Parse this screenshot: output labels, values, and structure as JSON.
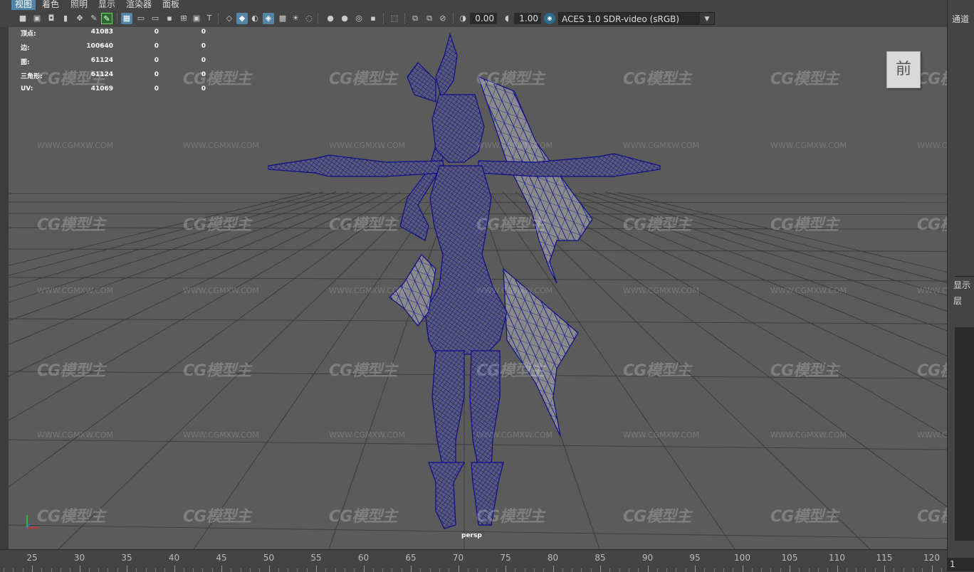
{
  "menu": {
    "items": [
      "视图",
      "着色",
      "照明",
      "显示",
      "渲染器",
      "面板"
    ],
    "active_index": 0
  },
  "toolbar": {
    "icons": [
      "camera-icon",
      "camera-attr-icon",
      "bookmark-icon",
      "image-plane-icon",
      "2d-pan-icon",
      "grease-pencil-icon",
      "grid-icon",
      "film-gate-icon",
      "resolution-gate-icon",
      "gate-mask-icon",
      "field-chart-icon",
      "safe-action-icon",
      "safe-title-icon",
      "wireframe-icon",
      "smooth-shade-icon",
      "default-material-icon",
      "wireframe-on-shaded-icon",
      "xray-icon",
      "textured-icon",
      "use-all-lights-icon",
      "shadows-icon",
      "screen-space-ao-icon",
      "motion-blur-icon",
      "multisample-aa-icon",
      "depth-of-field-icon",
      "isolate-select-icon",
      "xray-joints-icon",
      "xray-active-icon",
      "backface-culling-icon",
      "exposure-icon",
      "gamma-icon",
      "color-management-icon"
    ],
    "exposure_value": "0.00",
    "gamma_value": "1.00",
    "color_space": "ACES 1.0 SDR-video (sRGB)"
  },
  "hud": {
    "rows": [
      {
        "label": "顶点:",
        "v1": "41083",
        "v2": "0",
        "v3": "0"
      },
      {
        "label": "边:",
        "v1": "100640",
        "v2": "0",
        "v3": "0"
      },
      {
        "label": "面:",
        "v1": "61124",
        "v2": "0",
        "v3": "0"
      },
      {
        "label": "三角形:",
        "v1": "61124",
        "v2": "0",
        "v3": "0"
      },
      {
        "label": "UV:",
        "v1": "41069",
        "v2": "0",
        "v3": "0"
      }
    ]
  },
  "viewport": {
    "camera": "persp",
    "viewcube_label": "前",
    "watermark_logo": "CG模型主",
    "watermark_url": "WWW.CGMXW.COM",
    "wire_color": "#0d0d8a",
    "bg_color": "#5b5b5b"
  },
  "right_panel": {
    "top_label": "通道",
    "display_label": "显示",
    "layer_label": "层"
  },
  "timeline": {
    "labels": [
      "25",
      "30",
      "35",
      "40",
      "45",
      "50",
      "55",
      "60",
      "65",
      "70",
      "75",
      "80",
      "85",
      "90",
      "95",
      "100",
      "105",
      "110",
      "115",
      "120"
    ],
    "current_frame": "1"
  }
}
